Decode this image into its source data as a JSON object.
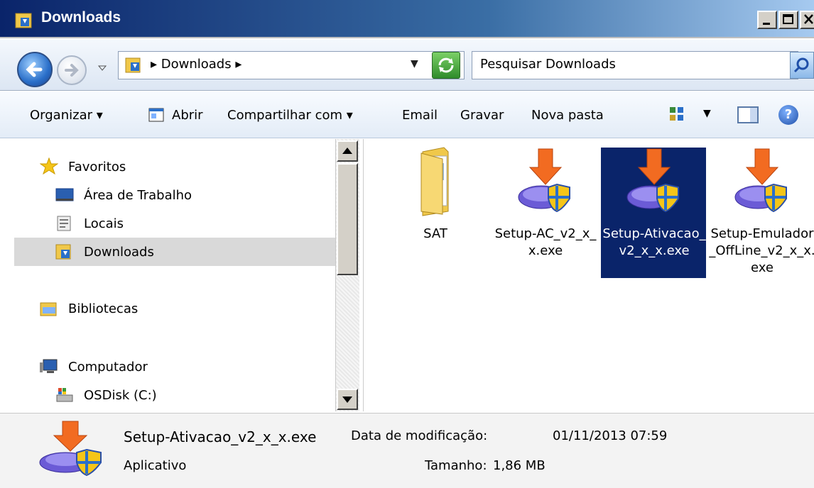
{
  "window": {
    "title": "Downloads"
  },
  "address": {
    "path": "▸ Downloads ▸",
    "search_placeholder": "Pesquisar Downloads"
  },
  "toolbar": {
    "organizar": "Organizar ▾",
    "abrir": "Abrir",
    "compartilhar": "Compartilhar com ▾",
    "email": "Email",
    "gravar": "Gravar",
    "nova_pasta": "Nova pasta",
    "help": "?"
  },
  "nav": {
    "favoritos": "Favoritos",
    "area_trabalho": "Área de Trabalho",
    "locais": "Locais",
    "downloads": "Downloads",
    "bibliotecas": "Bibliotecas",
    "computador": "Computador",
    "osdisk": "OSDisk (C:)"
  },
  "files": [
    {
      "name": "SAT"
    },
    {
      "name": "Setup-AC_v2_x_x.exe"
    },
    {
      "name": "Setup-Ativacao_v2_x_x.exe"
    },
    {
      "name": "Setup-Emulador_OffLine_v2_x_x.exe"
    }
  ],
  "details": {
    "name": "Setup-Ativacao_v2_x_x.exe",
    "modified_label": "Data de modificação:",
    "modified_value": "01/11/2013 07:59",
    "type": "Aplicativo",
    "size_label": "Tamanho:",
    "size_value": "1,86 MB"
  },
  "colors": {
    "selection": "#0a246a",
    "titlebar": "#0a246a"
  }
}
